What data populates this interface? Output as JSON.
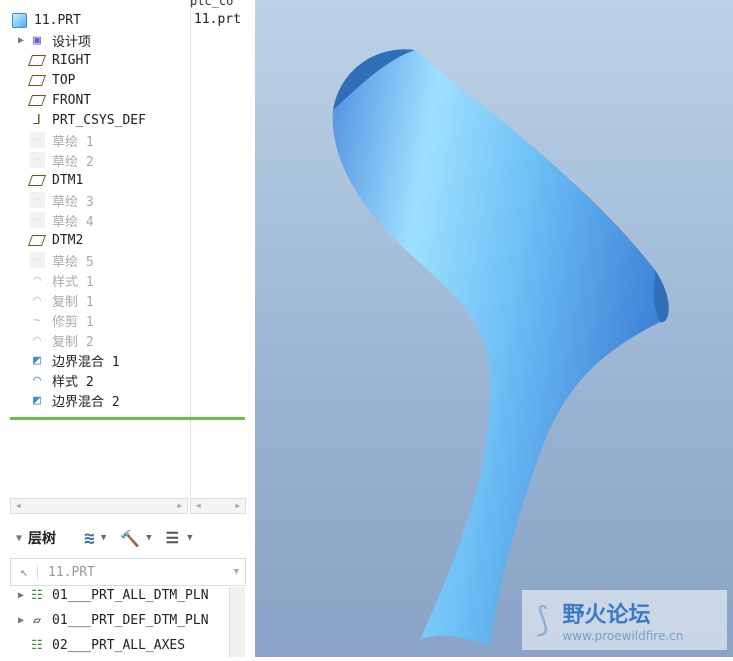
{
  "model_tree": {
    "column_header": "ptc_co",
    "column_value": "11.prt",
    "root": "11.PRT",
    "items": [
      {
        "label": "设计项",
        "type": "group",
        "expand": true
      },
      {
        "label": "RIGHT",
        "type": "plane"
      },
      {
        "label": "TOP",
        "type": "plane"
      },
      {
        "label": "FRONT",
        "type": "plane"
      },
      {
        "label": "PRT_CSYS_DEF",
        "type": "csys"
      },
      {
        "label": "草绘 1",
        "type": "sketch",
        "dim": true
      },
      {
        "label": "草绘 2",
        "type": "sketch",
        "dim": true
      },
      {
        "label": "DTM1",
        "type": "plane"
      },
      {
        "label": "草绘 3",
        "type": "sketch",
        "dim": true
      },
      {
        "label": "草绘 4",
        "type": "sketch",
        "dim": true
      },
      {
        "label": "DTM2",
        "type": "plane"
      },
      {
        "label": "草绘 5",
        "type": "sketch",
        "dim": true
      },
      {
        "label": "样式 1",
        "type": "style",
        "dim": true
      },
      {
        "label": "复制 1",
        "type": "copy",
        "dim": true
      },
      {
        "label": "修剪 1",
        "type": "trim",
        "dim": true
      },
      {
        "label": "复制 2",
        "type": "copy",
        "dim": true
      },
      {
        "label": "边界混合 1",
        "type": "blend"
      },
      {
        "label": "样式 2",
        "type": "style"
      },
      {
        "label": "边界混合 2",
        "type": "blend"
      }
    ]
  },
  "layer_tree": {
    "title": "层树",
    "selector": "11.PRT",
    "items": [
      "01___PRT_ALL_DTM_PLN",
      "01___PRT_DEF_DTM_PLN",
      "02___PRT_ALL_AXES"
    ]
  },
  "watermark": {
    "title": "野火论坛",
    "url": "www.proewildfire.cn"
  }
}
